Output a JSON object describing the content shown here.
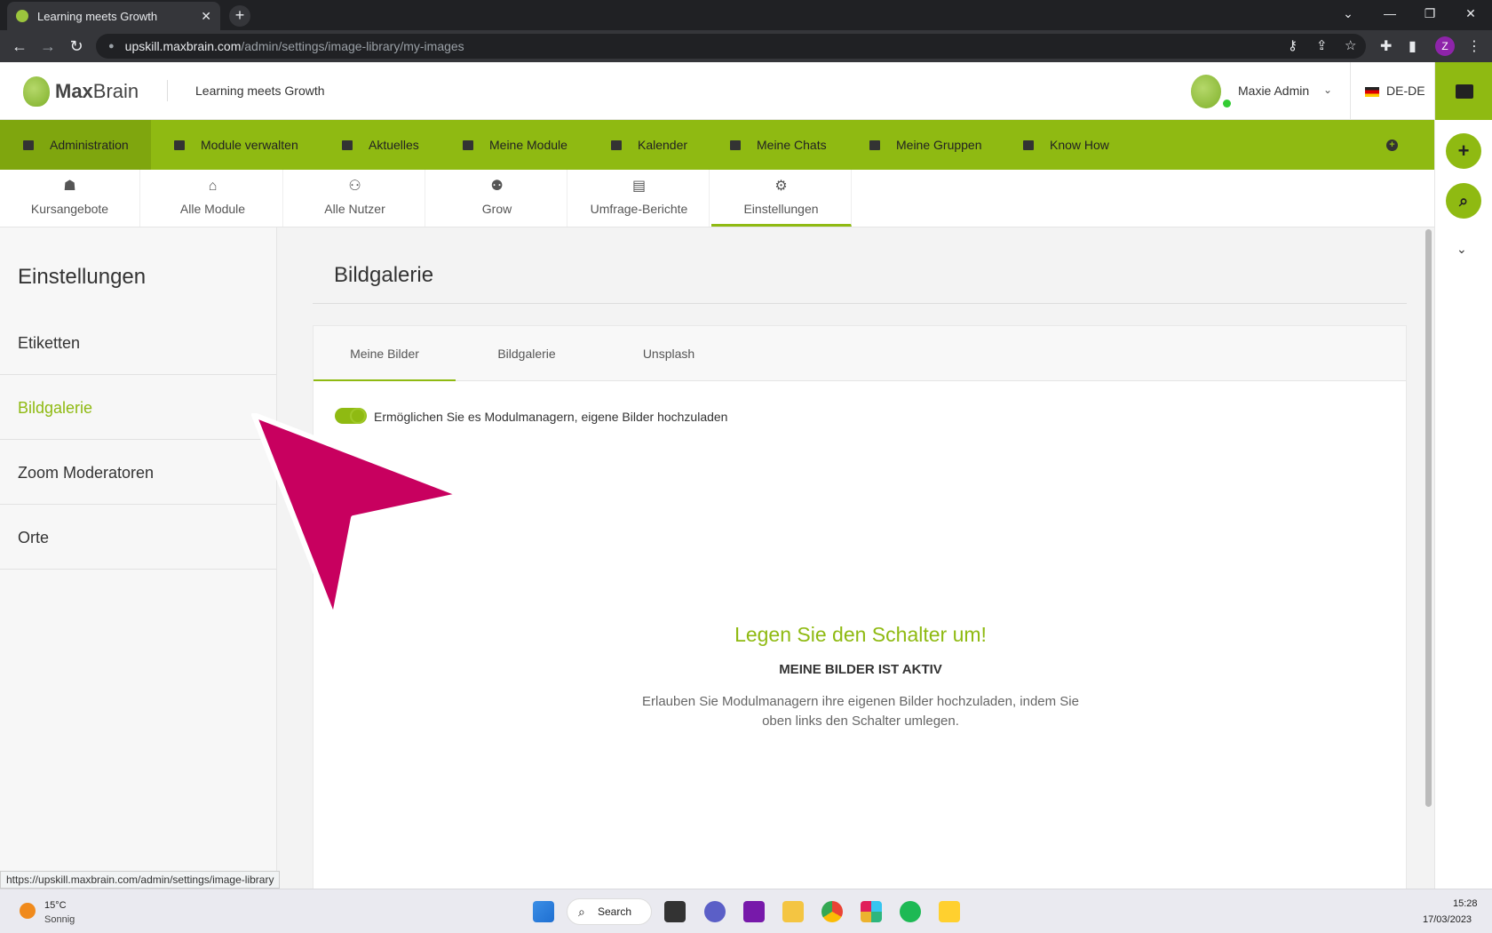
{
  "browser": {
    "tab_title": "Learning meets Growth",
    "tab_close": "✕",
    "new_tab": "+",
    "url_host": "upskill.maxbrain.com",
    "url_path": "/admin/settings/image-library/my-images",
    "profile_initial": "Z",
    "status_url": "https://upskill.maxbrain.com/admin/settings/image-library"
  },
  "header": {
    "brand_bold": "Max",
    "brand_light": "Brain",
    "tagline": "Learning meets Growth",
    "user_name": "Maxie Admin",
    "language": "DE-DE"
  },
  "main_nav": {
    "items": [
      {
        "label": "Administration",
        "icon": "dashboard-icon",
        "active": true
      },
      {
        "label": "Module verwalten",
        "icon": "folder-manage-icon"
      },
      {
        "label": "Aktuelles",
        "icon": "news-icon"
      },
      {
        "label": "Meine Module",
        "icon": "graduation-cap-icon"
      },
      {
        "label": "Kalender",
        "icon": "calendar-icon"
      },
      {
        "label": "Meine Chats",
        "icon": "chat-icon"
      },
      {
        "label": "Meine Gruppen",
        "icon": "groups-folder-icon"
      },
      {
        "label": "Know How",
        "icon": "book-icon"
      }
    ]
  },
  "sub_tabs": {
    "items": [
      {
        "label": "Kursangebote",
        "icon": "course-offer-icon"
      },
      {
        "label": "Alle Module",
        "icon": "institution-icon"
      },
      {
        "label": "Alle Nutzer",
        "icon": "users-icon"
      },
      {
        "label": "Grow",
        "icon": "group-grow-icon"
      },
      {
        "label": "Umfrage-Berichte",
        "icon": "report-file-icon"
      },
      {
        "label": "Einstellungen",
        "icon": "gears-icon",
        "active": true
      }
    ]
  },
  "settings_menu": {
    "title": "Einstellungen",
    "items": [
      {
        "label": "Etiketten"
      },
      {
        "label": "Bildgalerie",
        "active": true
      },
      {
        "label": "Zoom Moderatoren"
      },
      {
        "label": "Orte"
      }
    ]
  },
  "content": {
    "title": "Bildgalerie",
    "tabs": [
      {
        "label": "Meine Bilder",
        "active": true
      },
      {
        "label": "Bildgalerie"
      },
      {
        "label": "Unsplash"
      }
    ],
    "toggle_label": "Ermöglichen Sie es Modulmanagern, eigene Bilder hochzuladen",
    "toggle_on": true,
    "empty_title": "Legen Sie den Schalter um!",
    "empty_subtitle": "MEINE BILDER IST AKTIV",
    "empty_desc": "Erlauben Sie Modulmanagern ihre eigenen Bilder hochzuladen, indem Sie oben links den Schalter umlegen."
  },
  "taskbar": {
    "weather_temp": "15°C",
    "weather_desc": "Sonnig",
    "search_label": "Search",
    "time": "15:28",
    "date": "17/03/2023"
  },
  "colors": {
    "brand_green": "#8fba12",
    "annotation_pink": "#c8005f"
  }
}
